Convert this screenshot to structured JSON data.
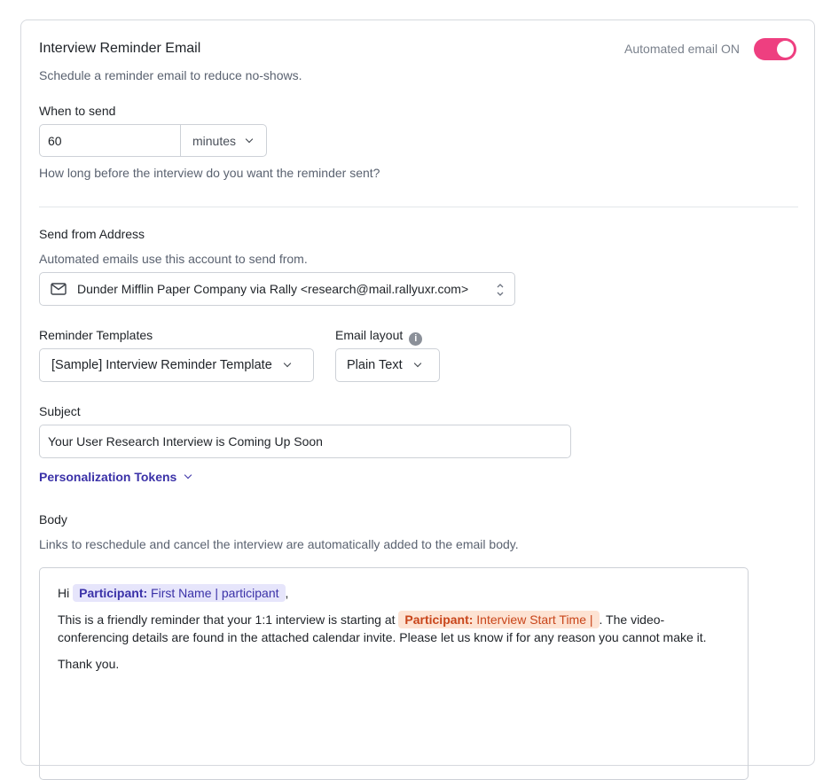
{
  "header": {
    "title": "Interview Reminder Email",
    "subtitle": "Schedule a reminder email to reduce no-shows.",
    "automated_label": "Automated email ON",
    "toggle_on": true,
    "accent_color": "#ee3f80"
  },
  "when_to_send": {
    "label": "When to send",
    "value": "60",
    "unit": "minutes",
    "help": "How long before the interview do you want the reminder sent?"
  },
  "send_from": {
    "label": "Send from Address",
    "help": "Automated emails use this account to send from.",
    "value": "Dunder Mifflin Paper Company via Rally <research@mail.rallyuxr.com>",
    "icon": "mail-icon"
  },
  "templates": {
    "label": "Reminder Templates",
    "value": "[Sample] Interview Reminder Template"
  },
  "email_layout": {
    "label": "Email layout",
    "value": "Plain Text",
    "info_icon": "i"
  },
  "subject": {
    "label": "Subject",
    "value": "Your User Research Interview is Coming Up Soon"
  },
  "tokens": {
    "label": "Personalization Tokens",
    "color": "#3b32a8"
  },
  "body": {
    "label": "Body",
    "help": "Links to reschedule and cancel the interview are automatically added to the email body.",
    "greeting_prefix": "Hi",
    "token1_key": "Participant:",
    "token1_value": "First Name | participant",
    "greeting_suffix": ",",
    "para_prefix": "This is a friendly reminder that your 1:1 interview is starting at",
    "token2_key": "Participant:",
    "token2_value": "Interview Start Time |",
    "para_suffix": ". The video-conferencing details are found in the attached calendar invite. Please let us know if for any reason you cannot make it.",
    "closing": "Thank you."
  }
}
